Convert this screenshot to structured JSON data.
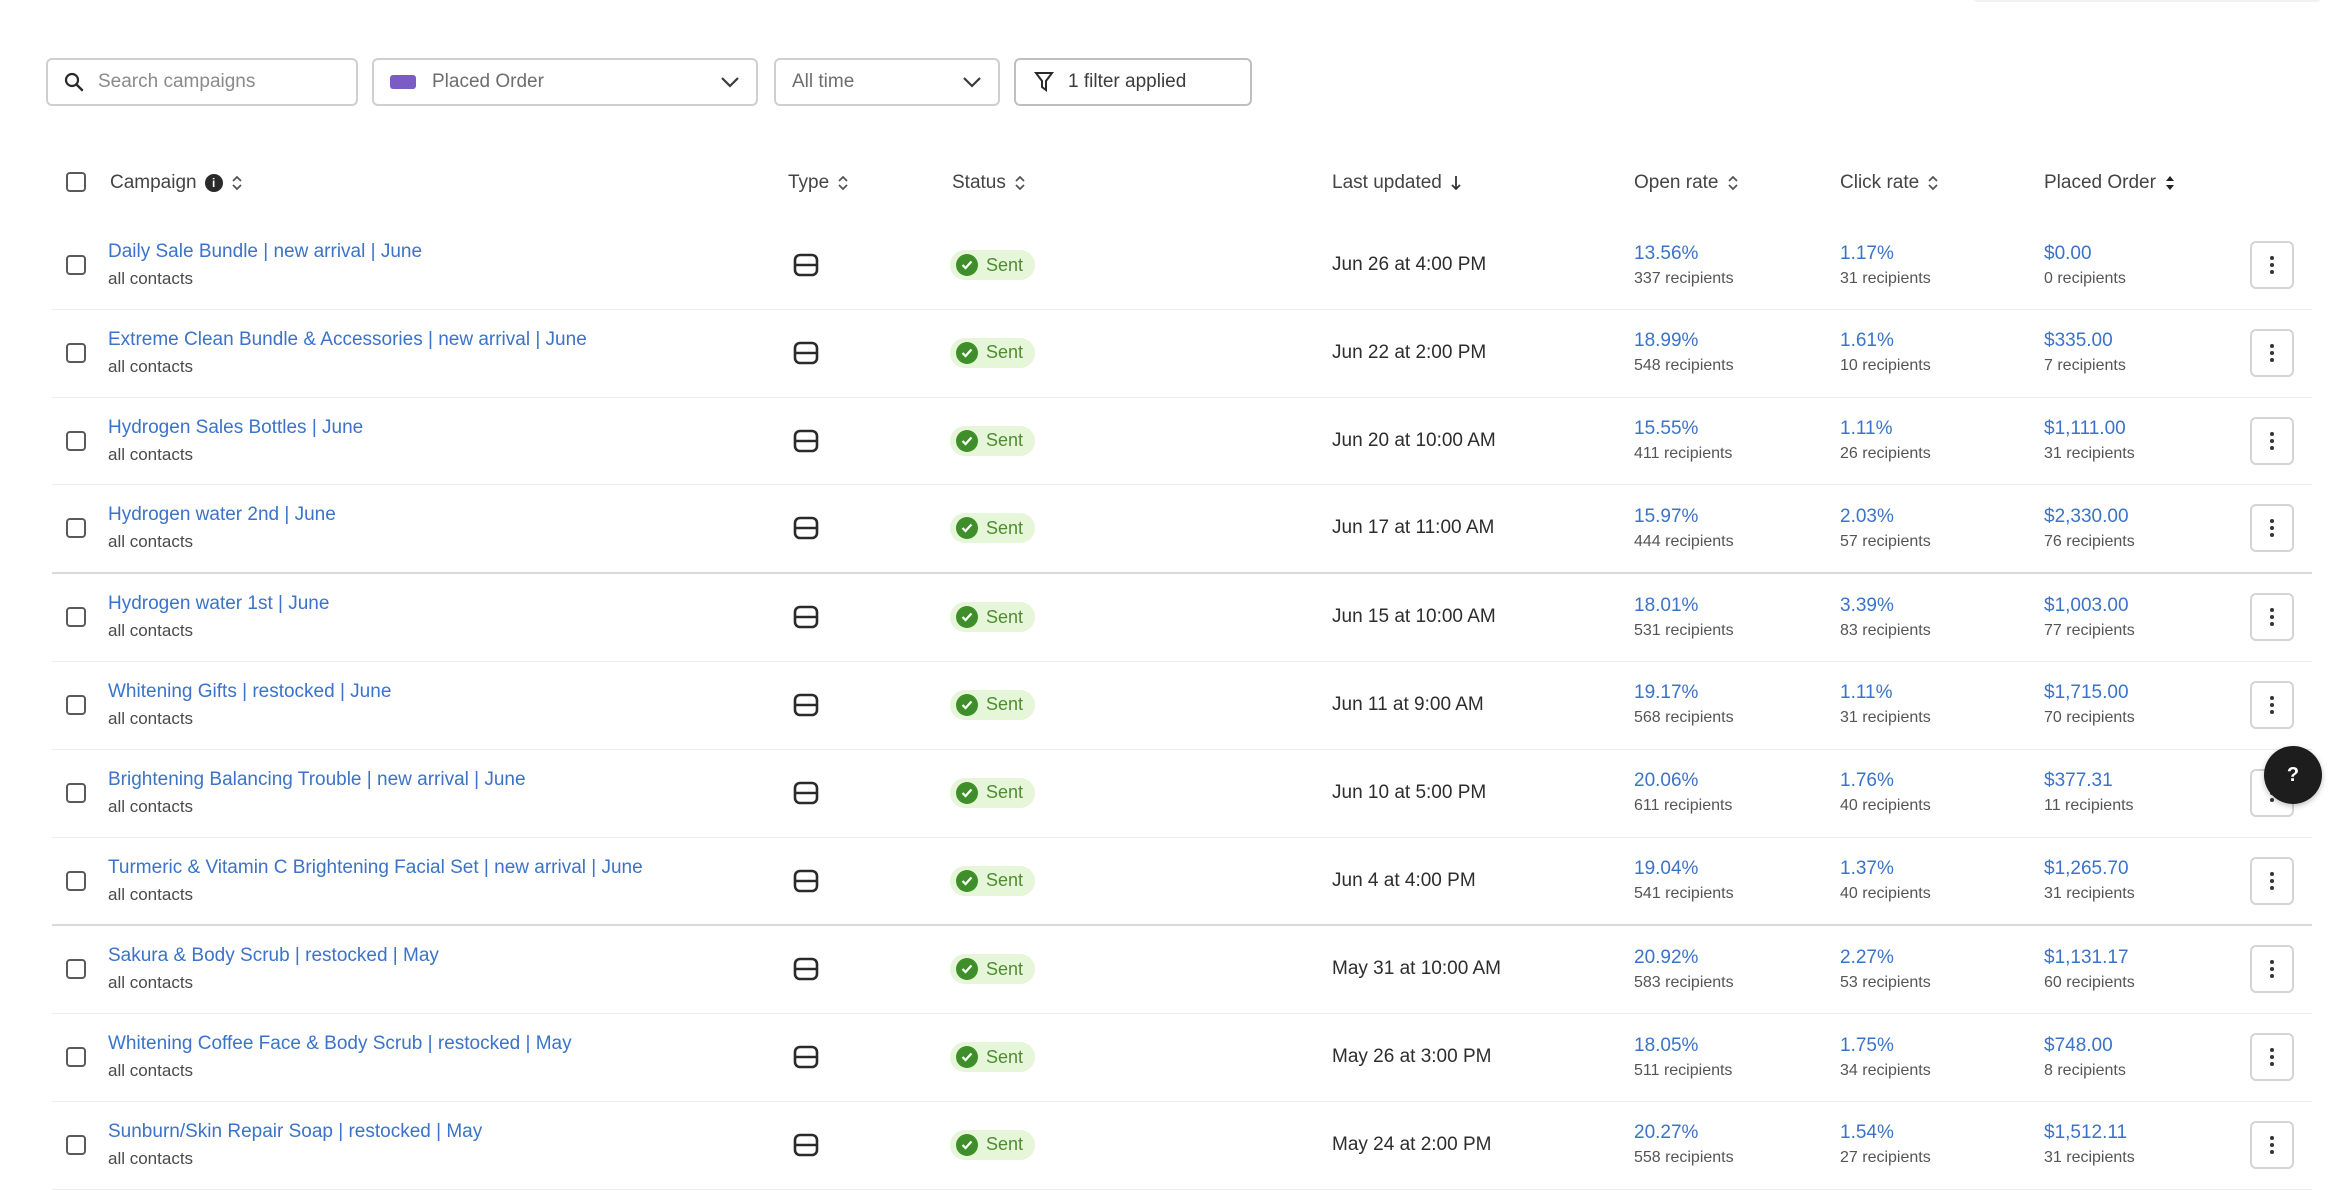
{
  "toolbar": {
    "search_placeholder": "Search campaigns",
    "saved_view_label": "Placed Order",
    "date_filter_label": "All time",
    "filter_button_label": "1 filter applied"
  },
  "table": {
    "headers": {
      "campaign": "Campaign",
      "type": "Type",
      "status": "Status",
      "last_updated": "Last updated",
      "open_rate": "Open rate",
      "click_rate": "Click rate",
      "placed_order": "Placed Order"
    },
    "rows": [
      {
        "name": "Daily Sale Bundle | new arrival | June",
        "audience": "all contacts",
        "type_icon": "email-icon",
        "status": "Sent",
        "updated": "Jun 26 at 4:00 PM",
        "open_rate": "13.56%",
        "open_sub": "337 recipients",
        "click_rate": "1.17%",
        "click_sub": "31 recipients",
        "order_value": "$0.00",
        "order_sub": "0 recipients"
      },
      {
        "name": "Extreme Clean Bundle & Accessories | new arrival | June",
        "audience": "all contacts",
        "type_icon": "email-icon",
        "status": "Sent",
        "updated": "Jun 22 at 2:00 PM",
        "open_rate": "18.99%",
        "open_sub": "548 recipients",
        "click_rate": "1.61%",
        "click_sub": "10 recipients",
        "order_value": "$335.00",
        "order_sub": "7 recipients"
      },
      {
        "name": "Hydrogen Sales Bottles | June",
        "audience": "all contacts",
        "type_icon": "email-icon",
        "status": "Sent",
        "updated": "Jun 20 at 10:00 AM",
        "open_rate": "15.55%",
        "open_sub": "411 recipients",
        "click_rate": "1.11%",
        "click_sub": "26 recipients",
        "order_value": "$1,111.00",
        "order_sub": "31 recipients"
      },
      {
        "name": "Hydrogen water 2nd | June",
        "audience": "all contacts",
        "type_icon": "email-icon",
        "status": "Sent",
        "updated": "Jun 17 at 11:00 AM",
        "open_rate": "15.97%",
        "open_sub": "444 recipients",
        "click_rate": "2.03%",
        "click_sub": "57 recipients",
        "order_value": "$2,330.00",
        "order_sub": "76 recipients"
      },
      {
        "name": "Hydrogen water 1st | June",
        "audience": "all contacts",
        "type_icon": "email-icon",
        "status": "Sent",
        "updated": "Jun 15 at 10:00 AM",
        "open_rate": "18.01%",
        "open_sub": "531 recipients",
        "click_rate": "3.39%",
        "click_sub": "83 recipients",
        "order_value": "$1,003.00",
        "order_sub": "77 recipients"
      },
      {
        "name": "Whitening Gifts | restocked | June",
        "audience": "all contacts",
        "type_icon": "email-icon",
        "status": "Sent",
        "updated": "Jun 11 at 9:00 AM",
        "open_rate": "19.17%",
        "open_sub": "568 recipients",
        "click_rate": "1.11%",
        "click_sub": "31 recipients",
        "order_value": "$1,715.00",
        "order_sub": "70 recipients"
      },
      {
        "name": "Brightening Balancing Trouble | new arrival | June",
        "audience": "all contacts",
        "type_icon": "email-icon",
        "status": "Sent",
        "updated": "Jun 10 at 5:00 PM",
        "open_rate": "20.06%",
        "open_sub": "611 recipients",
        "click_rate": "1.76%",
        "click_sub": "40 recipients",
        "order_value": "$377.31",
        "order_sub": "11 recipients"
      },
      {
        "name": "Turmeric & Vitamin C Brightening Facial Set | new arrival | June",
        "audience": "all contacts",
        "type_icon": "email-icon",
        "status": "Sent",
        "updated": "Jun 4 at 4:00 PM",
        "open_rate": "19.04%",
        "open_sub": "541 recipients",
        "click_rate": "1.37%",
        "click_sub": "40 recipients",
        "order_value": "$1,265.70",
        "order_sub": "31 recipients"
      },
      {
        "name": "Sakura & Body Scrub | restocked | May",
        "audience": "all contacts",
        "type_icon": "email-icon",
        "status": "Sent",
        "updated": "May 31 at 10:00 AM",
        "open_rate": "20.92%",
        "open_sub": "583 recipients",
        "click_rate": "2.27%",
        "click_sub": "53 recipients",
        "order_value": "$1,131.17",
        "order_sub": "60 recipients"
      },
      {
        "name": "Whitening Coffee Face & Body Scrub | restocked | May",
        "audience": "all contacts",
        "type_icon": "email-icon",
        "status": "Sent",
        "updated": "May 26 at 3:00 PM",
        "open_rate": "18.05%",
        "open_sub": "511 recipients",
        "click_rate": "1.75%",
        "click_sub": "34 recipients",
        "order_value": "$748.00",
        "order_sub": "8 recipients"
      },
      {
        "name": "Sunburn/Skin Repair Soap | restocked | May",
        "audience": "all contacts",
        "type_icon": "email-icon",
        "status": "Sent",
        "updated": "May 24 at 2:00 PM",
        "open_rate": "20.27%",
        "open_sub": "558 recipients",
        "click_rate": "1.54%",
        "click_sub": "27 recipients",
        "order_value": "$1,512.11",
        "order_sub": "31 recipients"
      }
    ]
  },
  "help_button_label": "?"
}
